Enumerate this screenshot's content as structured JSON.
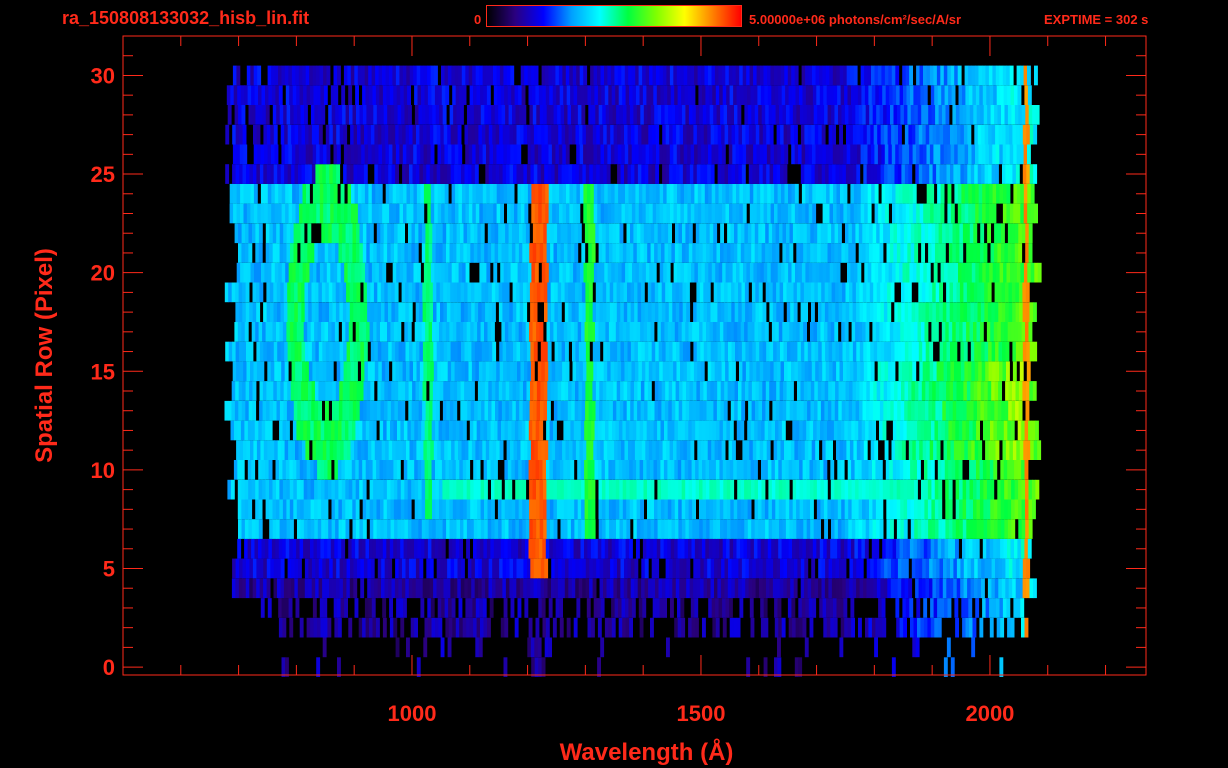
{
  "header": {
    "file_name": "ra_150808133032_hisb_lin.fit",
    "colorbar_min_label": "0",
    "colorbar_max_label": "5.00000e+06 photons/cm²/sec/A/sr",
    "exptime_label": "EXPTIME = 302 s"
  },
  "colors": {
    "text": "#ff2a1a",
    "background": "#000000",
    "axis": "#ff2a1a",
    "colormap": [
      "#000000",
      "#2a0080",
      "#0000ff",
      "#00a0ff",
      "#00ffff",
      "#00ff40",
      "#80ff00",
      "#ffff00",
      "#ff8000",
      "#ff0000"
    ]
  },
  "chart_data": {
    "type": "heatmap",
    "title": "ra_150808133032_hisb_lin.fit",
    "xlabel": "Wavelength (Å)",
    "ylabel": "Spatial Row (Pixel)",
    "xlim": [
      500,
      2270
    ],
    "ylim": [
      -0.4,
      32
    ],
    "xticks": [
      1000,
      1500,
      2000
    ],
    "xtick_labels": [
      "1000",
      "1500",
      "2000"
    ],
    "xminor_step": 100,
    "yticks": [
      0,
      5,
      10,
      15,
      20,
      25,
      30
    ],
    "ytick_labels": [
      "0",
      "5",
      "10",
      "15",
      "20",
      "25",
      "30"
    ],
    "yminor_step": 1,
    "colorbar": {
      "min": 0,
      "max": 5000000,
      "units": "photons/cm²/sec/A/sr"
    },
    "exptime_s": 302,
    "data_extent": {
      "x": [
        675,
        2075
      ],
      "rows": [
        0,
        30
      ]
    },
    "features": [
      {
        "name": "Lyman-alpha emission",
        "x_center": 1216,
        "x_width": 30,
        "rows": [
          5,
          24
        ],
        "level": 0.95
      },
      {
        "name": "line 1025",
        "x_center": 1025,
        "x_width": 14,
        "rows": [
          8,
          24
        ],
        "level": 0.55
      },
      {
        "name": "line 1304",
        "x_center": 1304,
        "x_width": 16,
        "rows": [
          7,
          24
        ],
        "level": 0.6
      },
      {
        "name": "red-end emission",
        "x_center": 2060,
        "x_width": 8,
        "rows": [
          2,
          30
        ],
        "level": 0.9
      },
      {
        "name": "bright band",
        "x_range": [
          1780,
          2060
        ],
        "rows": [
          11,
          15
        ],
        "level": 0.75
      },
      {
        "name": "ring feature",
        "x_center": 850,
        "rows": [
          11,
          24
        ],
        "level": 0.55
      }
    ]
  }
}
